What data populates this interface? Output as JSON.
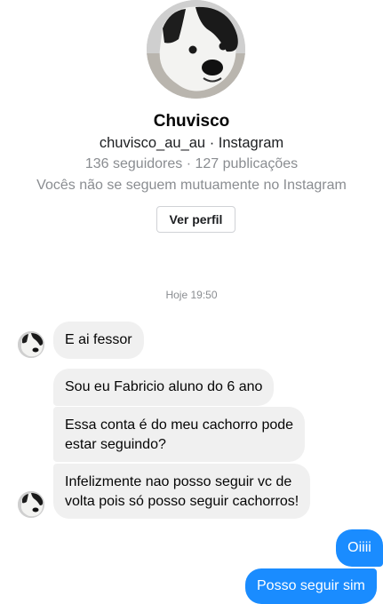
{
  "profile": {
    "name": "Chuvisco",
    "handle_line": "chuvisco_au_au · Instagram",
    "stats_line": "136 seguidores · 127 publicações",
    "mutual_line": "Vocês não se seguem mutuamente no Instagram",
    "view_button": "Ver perfil",
    "avatar_icon": "dog-photo"
  },
  "timestamp": "Hoje 19:50",
  "messages": [
    {
      "from": "them",
      "text": "E ai fessor"
    },
    {
      "from": "them",
      "text": "Sou eu Fabricio aluno do 6 ano"
    },
    {
      "from": "them",
      "lines": [
        "Essa conta é do meu cachorro pode",
        "estar seguindo?"
      ]
    },
    {
      "from": "them",
      "lines": [
        "Infelizmente nao posso seguir vc de",
        "volta pois só posso seguir cachorros!"
      ]
    },
    {
      "from": "me",
      "text": "Oiiii"
    },
    {
      "from": "me",
      "text": "Posso seguir sim"
    }
  ],
  "colors": {
    "outgoing_bubble": "#1a8cff",
    "incoming_bubble": "#f0f0f0",
    "secondary_text": "#8a8d91"
  }
}
